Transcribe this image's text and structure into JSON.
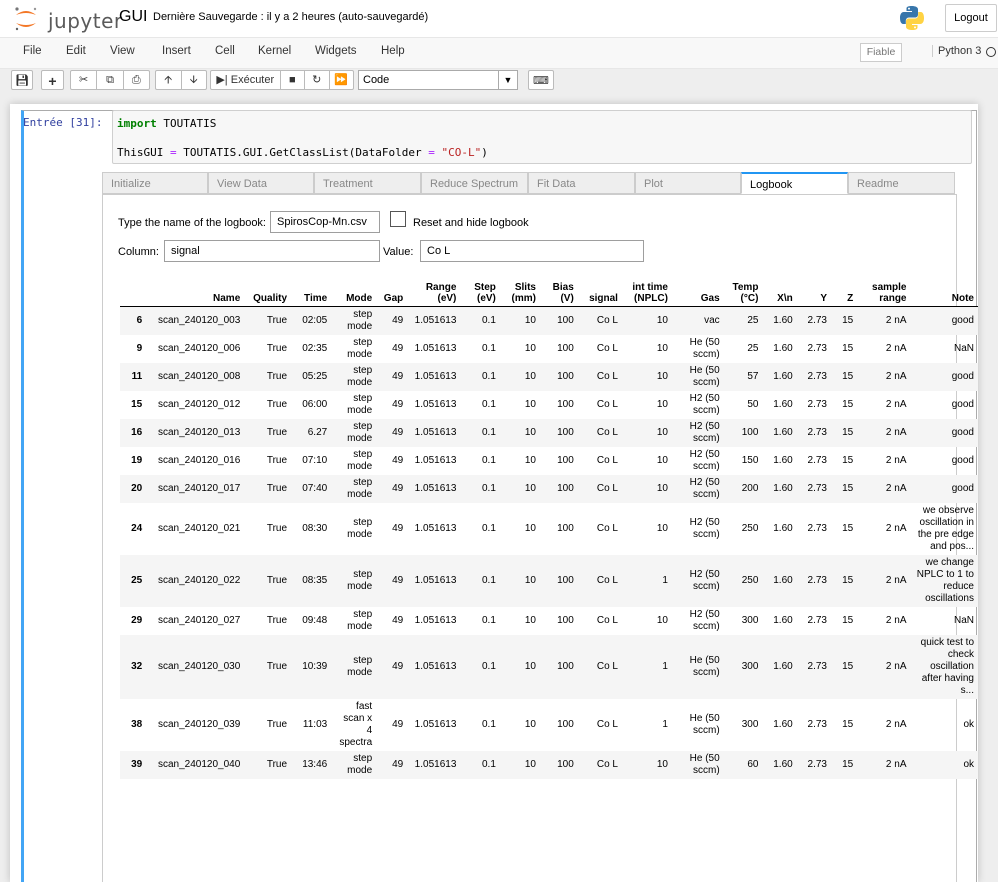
{
  "header": {
    "logo_text": "jupyter",
    "notebook_name": "GUI",
    "save_status": "Dernière Sauvegarde : il y a 2 heures   (auto-sauvegardé)",
    "logout_label": "Logout"
  },
  "menu": {
    "items": [
      "File",
      "Edit",
      "View",
      "Insert",
      "Cell",
      "Kernel",
      "Widgets",
      "Help"
    ],
    "trusted": "Fiable",
    "kernel": "Python 3"
  },
  "toolbar": {
    "run_label": "Exécuter",
    "cell_type": "Code"
  },
  "cell": {
    "prompt": "Entrée [31]:",
    "code_import_kw": "import",
    "code_import_rest": " TOUTATIS",
    "code_line2_var": "ThisGUI ",
    "code_line2_eq": "=",
    "code_line2_call": " TOUTATIS.GUI.GetClassList(DataFolder ",
    "code_line2_eq2": "=",
    "code_line2_str": " \"CO-L\"",
    "code_line2_end": ")"
  },
  "tabs": [
    "Initialize",
    "View Data",
    "Treatment",
    "Reduce Spectrum",
    "Fit Data",
    "Plot",
    "Logbook",
    "Readme"
  ],
  "logbook": {
    "name_label": "Type the name of the logbook:",
    "name_value": "SpirosCop-Mn.csv",
    "reset_label": "Reset and hide logbook",
    "column_label": "Column:",
    "column_value": "signal",
    "value_label": "Value:",
    "value_value": "Co L"
  },
  "table": {
    "headers": [
      "",
      "Name",
      "Quality",
      "Time",
      "Mode",
      "Gap",
      "Range (eV)",
      "Step (eV)",
      "Slits (mm)",
      "Bias (V)",
      "signal",
      "int time (NPLC)",
      "Gas",
      "Temp (°C)",
      "X\\n",
      "Y",
      "Z",
      "sample range",
      "Note"
    ],
    "rows": [
      [
        "6",
        "scan_240120_003",
        "True",
        "02:05",
        "step mode",
        "49",
        "1.051613",
        "0.1",
        "10",
        "100",
        "Co L",
        "10",
        "vac",
        "25",
        "1.60",
        "2.73",
        "15",
        "2 nA",
        "good"
      ],
      [
        "9",
        "scan_240120_006",
        "True",
        "02:35",
        "step mode",
        "49",
        "1.051613",
        "0.1",
        "10",
        "100",
        "Co L",
        "10",
        "He (50 sccm)",
        "25",
        "1.60",
        "2.73",
        "15",
        "2 nA",
        "NaN"
      ],
      [
        "11",
        "scan_240120_008",
        "True",
        "05:25",
        "step mode",
        "49",
        "1.051613",
        "0.1",
        "10",
        "100",
        "Co L",
        "10",
        "He (50 sccm)",
        "57",
        "1.60",
        "2.73",
        "15",
        "2 nA",
        "good"
      ],
      [
        "15",
        "scan_240120_012",
        "True",
        "06:00",
        "step mode",
        "49",
        "1.051613",
        "0.1",
        "10",
        "100",
        "Co L",
        "10",
        "H2 (50 sccm)",
        "50",
        "1.60",
        "2.73",
        "15",
        "2 nA",
        "good"
      ],
      [
        "16",
        "scan_240120_013",
        "True",
        "6.27",
        "step mode",
        "49",
        "1.051613",
        "0.1",
        "10",
        "100",
        "Co L",
        "10",
        "H2 (50 sccm)",
        "100",
        "1.60",
        "2.73",
        "15",
        "2 nA",
        "good"
      ],
      [
        "19",
        "scan_240120_016",
        "True",
        "07:10",
        "step mode",
        "49",
        "1.051613",
        "0.1",
        "10",
        "100",
        "Co L",
        "10",
        "H2 (50 sccm)",
        "150",
        "1.60",
        "2.73",
        "15",
        "2 nA",
        "good"
      ],
      [
        "20",
        "scan_240120_017",
        "True",
        "07:40",
        "step mode",
        "49",
        "1.051613",
        "0.1",
        "10",
        "100",
        "Co L",
        "10",
        "H2 (50 sccm)",
        "200",
        "1.60",
        "2.73",
        "15",
        "2 nA",
        "good"
      ],
      [
        "24",
        "scan_240120_021",
        "True",
        "08:30",
        "step mode",
        "49",
        "1.051613",
        "0.1",
        "10",
        "100",
        "Co L",
        "10",
        "H2 (50 sccm)",
        "250",
        "1.60",
        "2.73",
        "15",
        "2 nA",
        "we observe oscillation in the pre edge and pos..."
      ],
      [
        "25",
        "scan_240120_022",
        "True",
        "08:35",
        "step mode",
        "49",
        "1.051613",
        "0.1",
        "10",
        "100",
        "Co L",
        "1",
        "H2 (50 sccm)",
        "250",
        "1.60",
        "2.73",
        "15",
        "2 nA",
        "we change NPLC to 1 to reduce oscillations"
      ],
      [
        "29",
        "scan_240120_027",
        "True",
        "09:48",
        "step mode",
        "49",
        "1.051613",
        "0.1",
        "10",
        "100",
        "Co L",
        "10",
        "H2 (50 sccm)",
        "300",
        "1.60",
        "2.73",
        "15",
        "2 nA",
        "NaN"
      ],
      [
        "32",
        "scan_240120_030",
        "True",
        "10:39",
        "step mode",
        "49",
        "1.051613",
        "0.1",
        "10",
        "100",
        "Co L",
        "1",
        "He (50 sccm)",
        "300",
        "1.60",
        "2.73",
        "15",
        "2 nA",
        "quick test to check oscillation after having s..."
      ],
      [
        "38",
        "scan_240120_039",
        "True",
        "11:03",
        "fast scan x 4 spectra",
        "49",
        "1.051613",
        "0.1",
        "10",
        "100",
        "Co L",
        "1",
        "He (50 sccm)",
        "300",
        "1.60",
        "2.73",
        "15",
        "2 nA",
        "ok"
      ],
      [
        "39",
        "scan_240120_040",
        "True",
        "13:46",
        "step mode",
        "49",
        "1.051613",
        "0.1",
        "10",
        "100",
        "Co L",
        "10",
        "He (50 sccm)",
        "60",
        "1.60",
        "2.73",
        "15",
        "2 nA",
        "ok"
      ]
    ]
  }
}
